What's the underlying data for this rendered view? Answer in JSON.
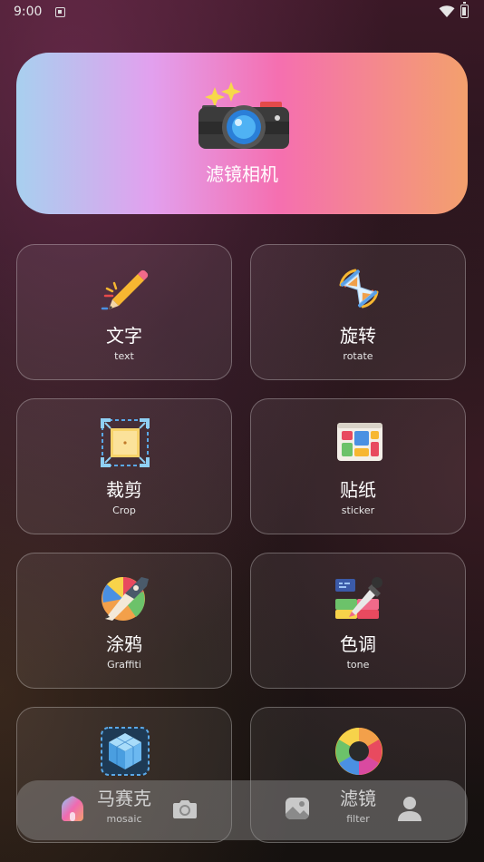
{
  "status_bar": {
    "time": "9:00"
  },
  "banner": {
    "title": "滤镜相机",
    "icon": "camera-icon"
  },
  "tools": [
    {
      "title": "文字",
      "subtitle": "text",
      "icon": "pencil-icon"
    },
    {
      "title": "旋转",
      "subtitle": "rotate",
      "icon": "hourglass-icon"
    },
    {
      "title": "裁剪",
      "subtitle": "Crop",
      "icon": "crop-icon"
    },
    {
      "title": "贴纸",
      "subtitle": "sticker",
      "icon": "sticker-icon"
    },
    {
      "title": "涂鸦",
      "subtitle": "Graffiti",
      "icon": "pen-nib-icon"
    },
    {
      "title": "色调",
      "subtitle": "tone",
      "icon": "color-picker-icon"
    },
    {
      "title": "马赛克",
      "subtitle": "mosaic",
      "icon": "cube-icon"
    },
    {
      "title": "滤镜",
      "subtitle": "filter",
      "icon": "color-wheel-icon"
    }
  ],
  "bottom_nav": {
    "items": [
      {
        "icon": "home-icon",
        "active": true
      },
      {
        "icon": "camera-icon",
        "active": false
      },
      {
        "icon": "gallery-icon",
        "active": false
      },
      {
        "icon": "profile-icon",
        "active": false
      }
    ]
  },
  "colors": {
    "banner_gradient": [
      "#a8d0ef",
      "#e2a0ee",
      "#f56fb0",
      "#f3a06d"
    ],
    "card_border": "#6a5a60",
    "nav_background": "#8a8a8a"
  }
}
